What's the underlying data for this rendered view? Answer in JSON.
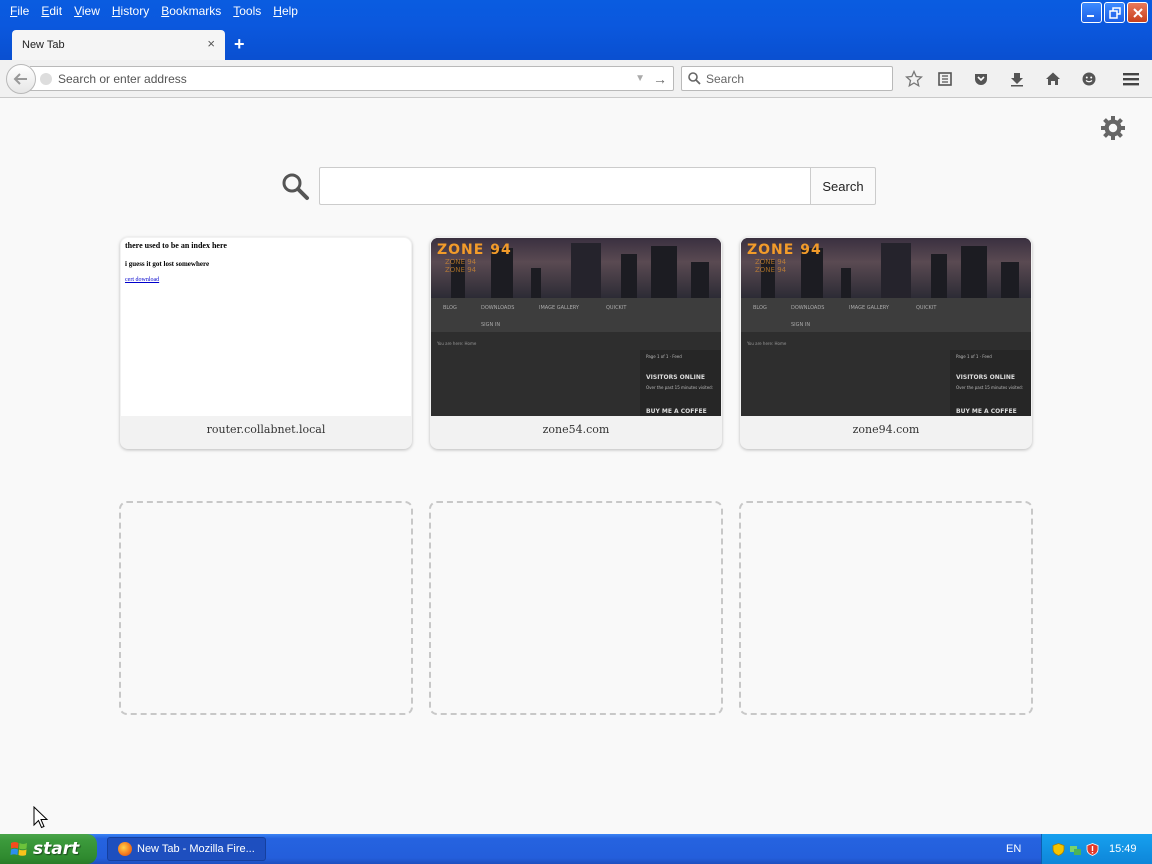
{
  "menu": [
    "File",
    "Edit",
    "View",
    "History",
    "Bookmarks",
    "Tools",
    "Help"
  ],
  "tab": {
    "title": "New Tab",
    "close": "×"
  },
  "newtab_label": "+",
  "urlbar": {
    "placeholder": "Search or enter address"
  },
  "searchbar": {
    "placeholder": "Search"
  },
  "page_search": {
    "button_label": "Search"
  },
  "tiles": [
    {
      "title": "router.collabnet.local",
      "thumb_lines": [
        "there used to be an index here",
        "i guess it got lost somewhere",
        "cert download"
      ]
    },
    {
      "title": "zone54.com"
    },
    {
      "title": "zone94.com"
    }
  ],
  "zone_thumb": {
    "logo": "ZONE 94",
    "logo_sub": "ZONE 94\nZONE 94",
    "nav": [
      "BLOG",
      "DOWNLOADS",
      "IMAGE GALLERY",
      "QUICKIT",
      "SIGN IN"
    ],
    "breadcrumb": "You are here:  Home",
    "side_items": [
      "Page 1 of 1 · Feed",
      "VISITORS ONLINE",
      "Over the past 15 minutes visited:",
      "BUY ME A COFFEE"
    ]
  },
  "taskbar": {
    "start_label": "start",
    "window_button": "New Tab - Mozilla Fire...",
    "language": "EN",
    "clock": "15:49"
  },
  "colors": {
    "titlebar": "#0b58de",
    "orange_logo": "#f29b2a",
    "start_green": "#3c9a3c",
    "tray_blue": "#16a0ef"
  }
}
